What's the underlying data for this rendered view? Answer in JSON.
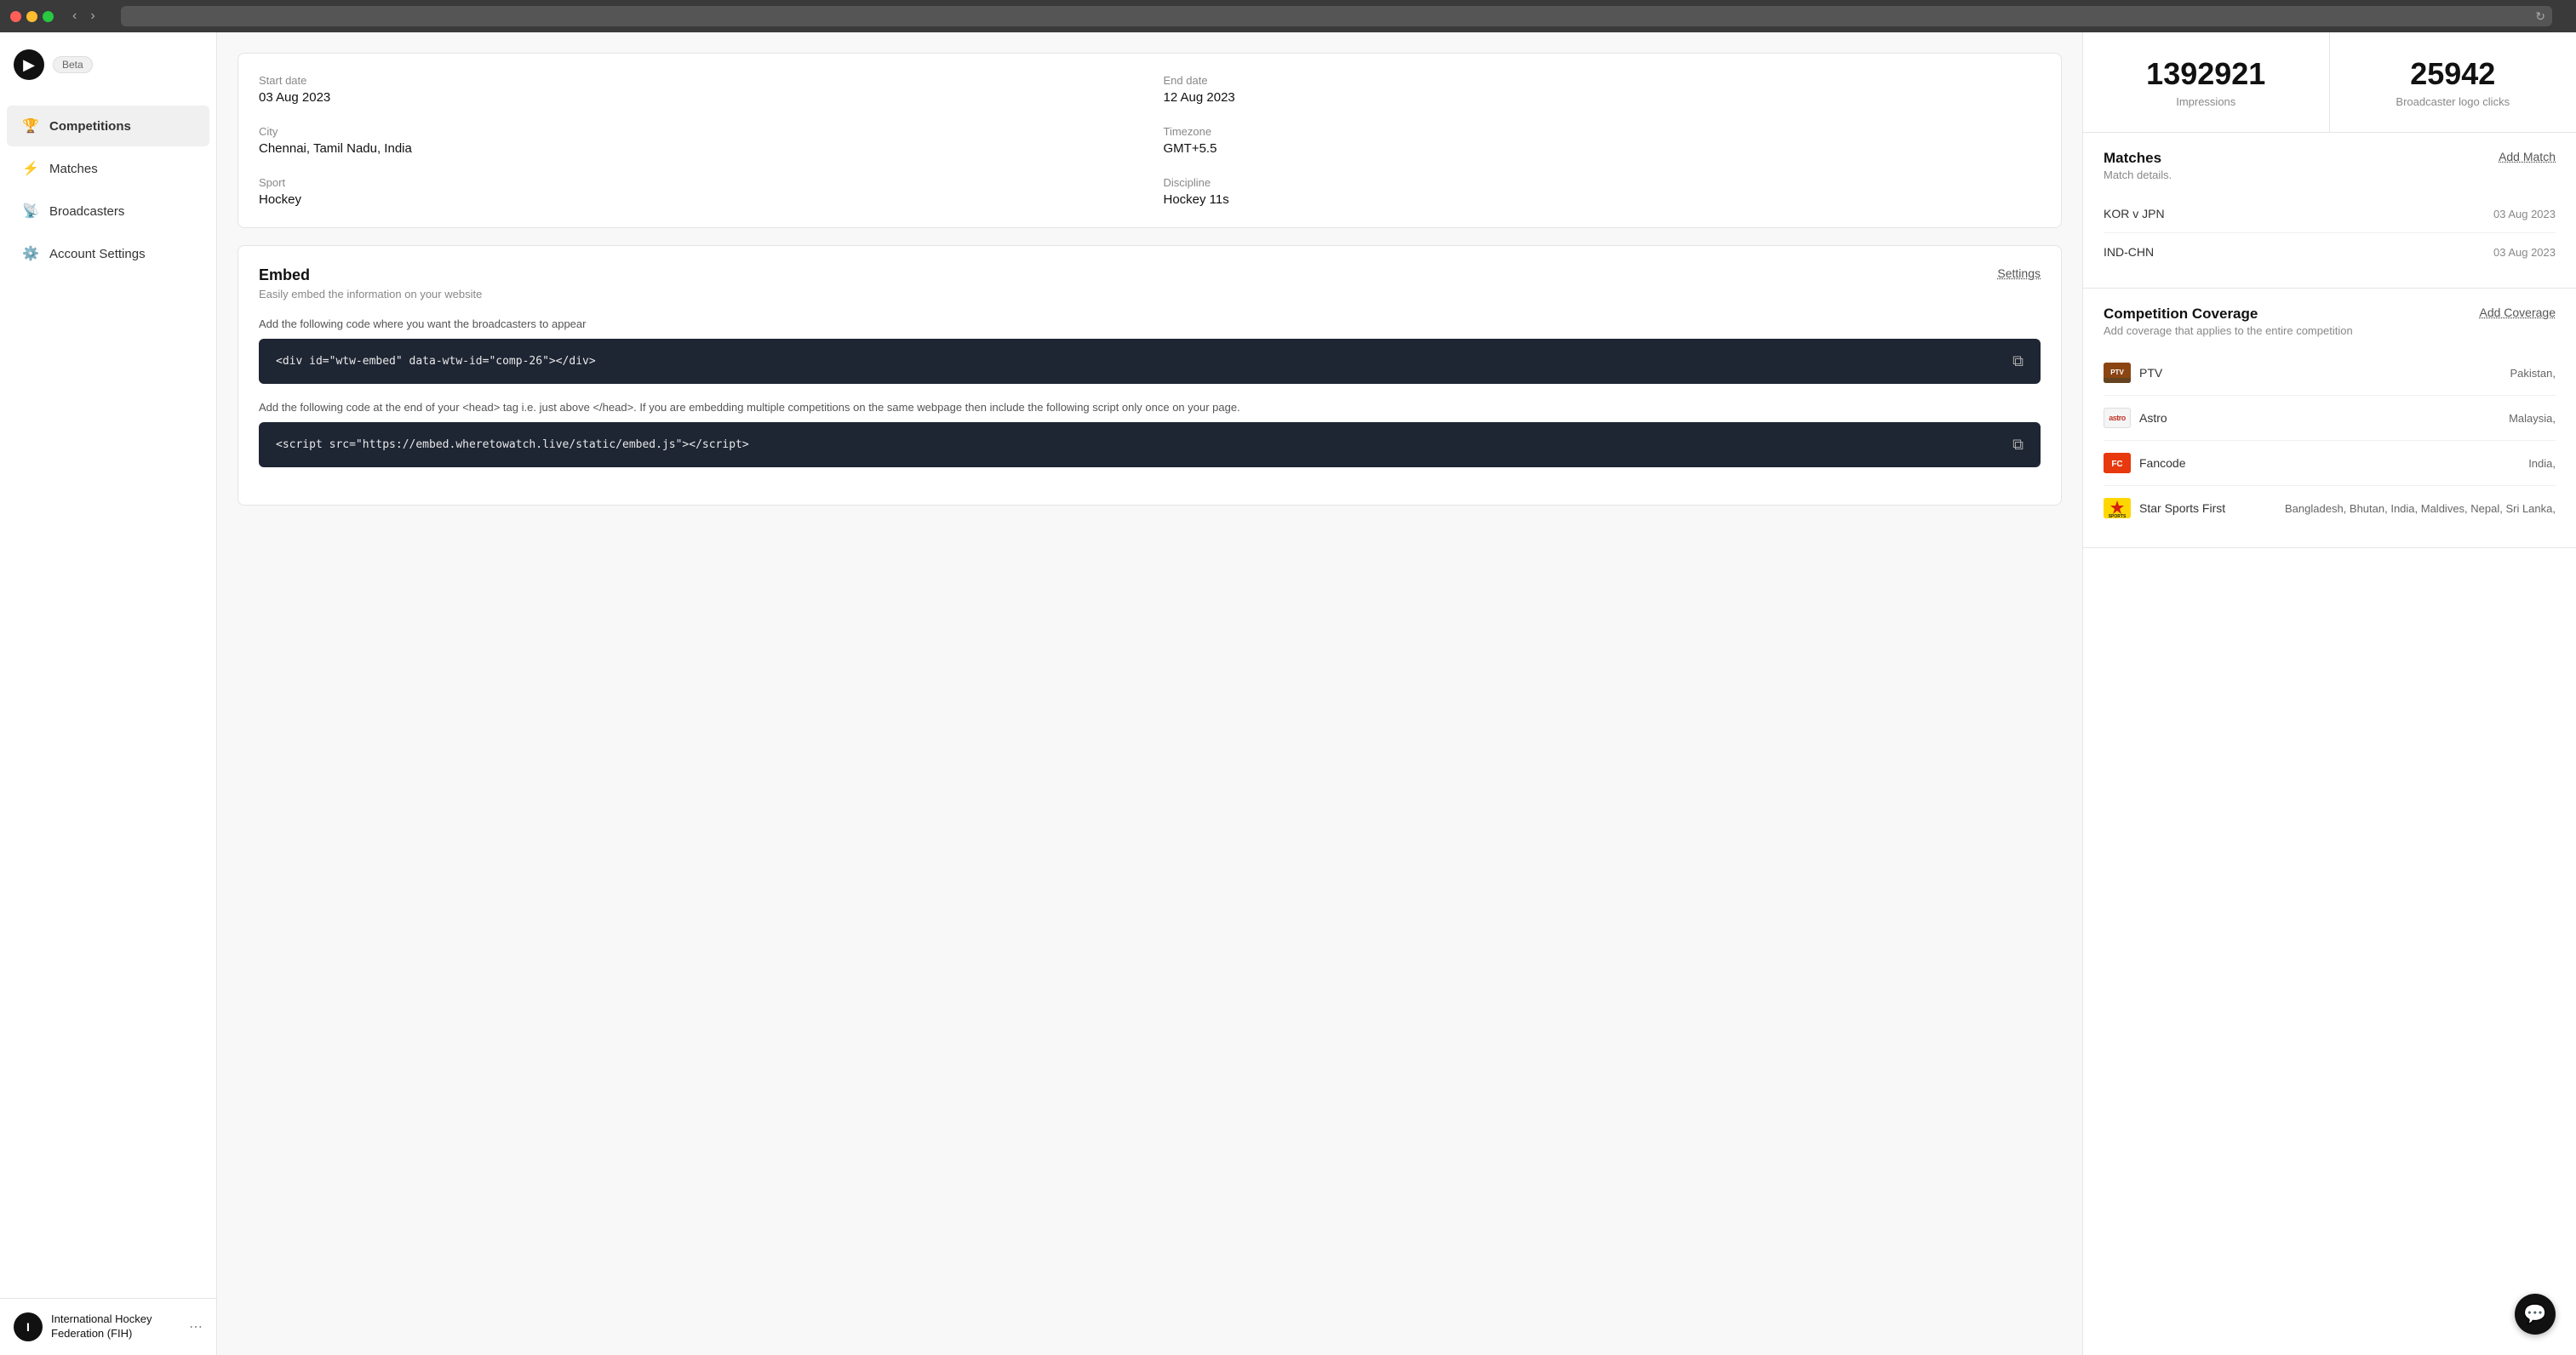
{
  "titlebar": {
    "nav_back": "‹",
    "nav_forward": "›",
    "reload": "↻"
  },
  "sidebar": {
    "logo_letter": "▶",
    "beta_label": "Beta",
    "nav_items": [
      {
        "id": "competitions",
        "label": "Competitions",
        "icon": "trophy",
        "active": true
      },
      {
        "id": "matches",
        "label": "Matches",
        "icon": "lightning",
        "active": false
      },
      {
        "id": "broadcasters",
        "label": "Broadcasters",
        "icon": "broadcast",
        "active": false
      },
      {
        "id": "account-settings",
        "label": "Account Settings",
        "icon": "gear",
        "active": false
      }
    ],
    "user": {
      "initials": "I",
      "name": "International Hockey\nFederation (FIH)",
      "more_icon": "⋯"
    }
  },
  "main": {
    "info_fields": [
      {
        "label": "Start date",
        "value": "03 Aug 2023"
      },
      {
        "label": "End date",
        "value": "12 Aug 2023"
      },
      {
        "label": "City",
        "value": "Chennai, Tamil Nadu, India"
      },
      {
        "label": "Timezone",
        "value": "GMT+5.5"
      },
      {
        "label": "Sport",
        "value": "Hockey"
      },
      {
        "label": "Discipline",
        "value": "Hockey 11s"
      }
    ],
    "embed": {
      "title": "Embed",
      "subtitle": "Easily embed the information on your website",
      "settings_label": "Settings",
      "instruction1": "Add the following code where you want the broadcasters to appear",
      "code1": "<div id=\"wtw-embed\" data-wtw-id=\"comp-26\"></div>",
      "instruction2": "Add the following code at the end of your <head> tag i.e. just above </head>. If you are embedding multiple competitions on the same webpage then include the following script only once on your page.",
      "code2": "<script src=\"https://embed.wheretowatch.live/static/embed.js\"></script>",
      "copy_icon": "⧉"
    }
  },
  "right_panel": {
    "stats": [
      {
        "value": "1392921",
        "label": "Impressions"
      },
      {
        "value": "25942",
        "label": "Broadcaster logo clicks"
      }
    ],
    "matches_section": {
      "title": "Matches",
      "subtitle": "Match details.",
      "add_label": "Add Match",
      "items": [
        {
          "name": "KOR v JPN",
          "date": "03 Aug 2023"
        },
        {
          "name": "IND-CHN",
          "date": "03 Aug 2023"
        }
      ]
    },
    "coverage_section": {
      "title": "Competition Coverage",
      "subtitle": "Add coverage that applies to the entire competition",
      "add_label": "Add Coverage",
      "items": [
        {
          "name": "PTV",
          "country": "Pakistan,",
          "logo_type": "ptv"
        },
        {
          "name": "Astro",
          "country": "Malaysia,",
          "logo_type": "astro"
        },
        {
          "name": "Fancode",
          "country": "India,",
          "logo_type": "fancode"
        },
        {
          "name": "Star Sports First",
          "country": "Bangladesh, Bhutan, India, Maldives, Nepal, Sri Lanka,",
          "logo_type": "star"
        }
      ]
    }
  },
  "chat_btn": "💬"
}
